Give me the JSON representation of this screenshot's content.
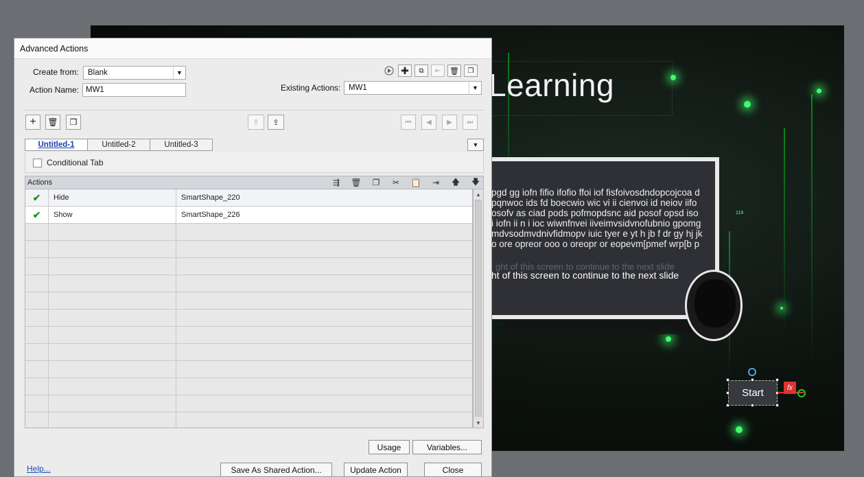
{
  "slide": {
    "title": "Learning",
    "textbox_lines": [
      "pgd gg iofn fifio ifofio ffoi iof   fisfoivosdndopcojcoa d",
      "pqnwoc ids fd boecwio wic vi ii cienvoi id neiov iifo",
      "osofv as ciad pods pofmopdsnc aid posof opsd iso",
      "i iofn ii n i ioc wiwnfnvei iiveimvsidvnofubnio gpomg",
      "mdvsodmvdnivfidmopv iuic tyer e yt h jb f dr gy hj jk",
      "o ore opreor ooo o oreopr or eopevm[pmef wrp[b p"
    ],
    "next_text": "ht of this screen to continue to the next slide",
    "faded_text": "ght of this screen to continue to the next slide",
    "start_button": "Start",
    "fx_badge": "fx",
    "counter_badge": "119"
  },
  "dialog": {
    "title": "Advanced Actions",
    "create_from_label": "Create from:",
    "create_from_value": "Blank",
    "action_name_label": "Action Name:",
    "action_name_value": "MW1",
    "existing_actions_label": "Existing Actions:",
    "existing_actions_value": "MW1",
    "tabs": [
      {
        "label": "Untitled-1",
        "active": true
      },
      {
        "label": "Untitled-2",
        "active": false
      },
      {
        "label": "Untitled-3",
        "active": false
      }
    ],
    "conditional_tab_label": "Conditional Tab",
    "actions_header": "Actions",
    "actions": [
      {
        "checked": true,
        "action": "Hide",
        "target": "SmartShape_220"
      },
      {
        "checked": true,
        "action": "Show",
        "target": "SmartShape_226"
      }
    ],
    "empty_rows": 12,
    "usage_button": "Usage",
    "variables_button": "Variables...",
    "help_link": "Help...",
    "save_shared_button": "Save As Shared Action...",
    "update_button": "Update Action",
    "close_button": "Close",
    "check_glyph": "✔"
  },
  "colors": {
    "active_tab": "#1c3fa8",
    "check": "#1a9a1a",
    "glow": "#3cff6a",
    "fx": "#dd3333"
  }
}
